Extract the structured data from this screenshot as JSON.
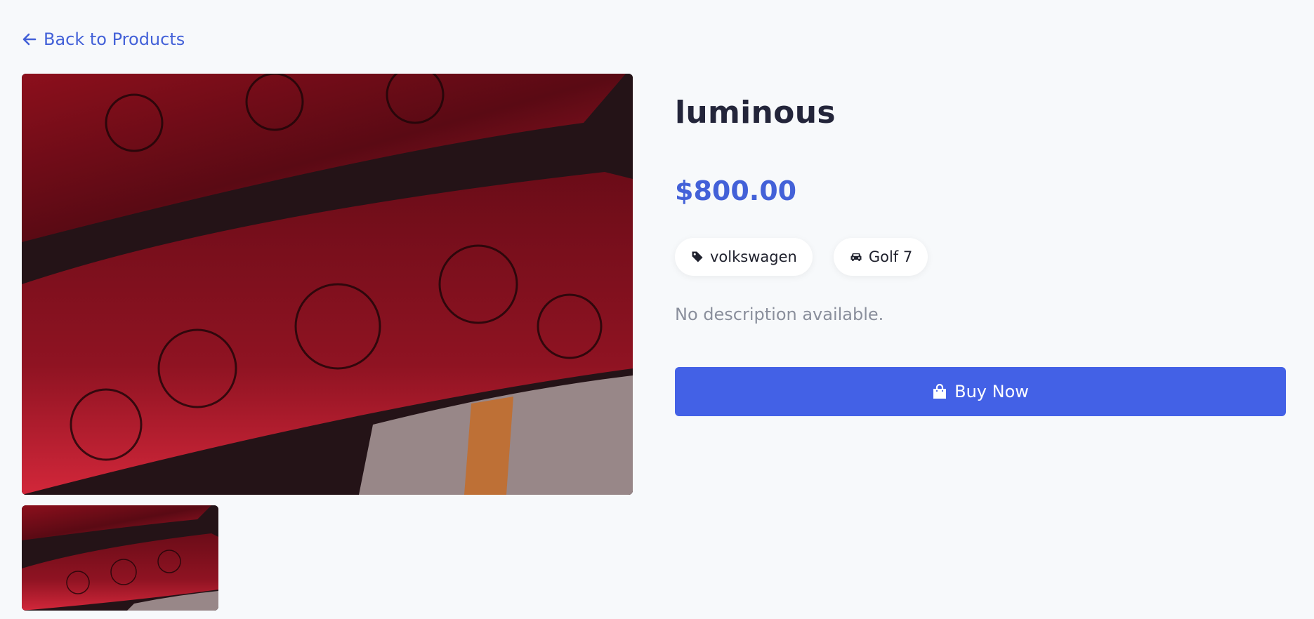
{
  "nav": {
    "back_label": "Back to Products",
    "back_icon": "arrow-left-icon"
  },
  "product": {
    "title": "luminous",
    "price": "$800.00",
    "brand": "volkswagen",
    "brand_icon": "tag-icon",
    "model": "Golf 7",
    "model_icon": "car-icon",
    "description": "No description available."
  },
  "actions": {
    "buy_label": "Buy Now",
    "buy_icon": "shopping-bag-icon"
  },
  "colors": {
    "accent": "#4361e6",
    "link": "#4361d8",
    "background": "#f7f9fb"
  }
}
